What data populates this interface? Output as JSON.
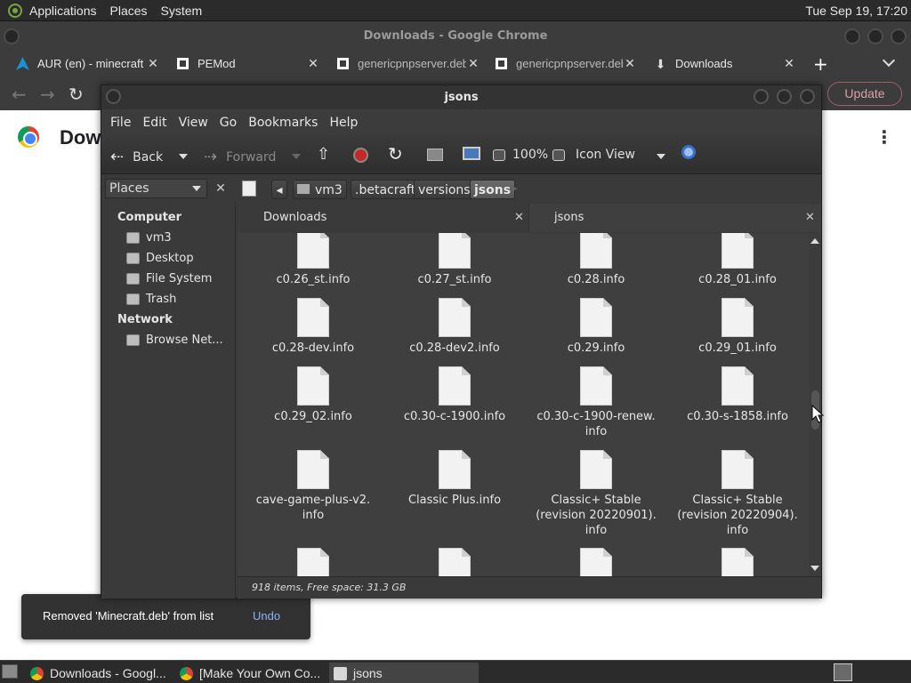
{
  "top_panel": {
    "menus": [
      "Applications",
      "Places",
      "System"
    ],
    "clock": "Tue Sep 19, 17:20"
  },
  "chrome": {
    "window_title": "Downloads - Google Chrome",
    "tabs": [
      {
        "label": "AUR (en) - minecraft",
        "icon": "arch-icon"
      },
      {
        "label": "PEMod",
        "icon": "github-icon"
      },
      {
        "label": "genericpnpserver.deb",
        "icon": "github-icon"
      },
      {
        "label": "genericpnpserver.deb",
        "icon": "github-icon"
      },
      {
        "label": "Downloads",
        "icon": "download-icon"
      }
    ],
    "update_label": "Update",
    "page_heading": "Dow",
    "snackbar": {
      "message": "Removed 'Minecraft.deb' from list",
      "action": "Undo"
    }
  },
  "caja": {
    "title": "jsons",
    "menu": [
      "File",
      "Edit",
      "View",
      "Go",
      "Bookmarks",
      "Help"
    ],
    "toolbar": {
      "back": "Back",
      "forward": "Forward",
      "zoom": "100%",
      "view_mode": "Icon View"
    },
    "places_label": "Places",
    "sidebar": {
      "computer_heading": "Computer",
      "computer_items": [
        "vm3",
        "Desktop",
        "File System",
        "Trash"
      ],
      "network_heading": "Network",
      "network_items": [
        "Browse Net..."
      ]
    },
    "breadcrumbs": [
      "vm3",
      ".betacraft",
      "versions",
      "jsons"
    ],
    "tabs": [
      "Downloads",
      "jsons"
    ],
    "files": [
      "c0.26_st.info",
      "c0.27_st.info",
      "c0.28.info",
      "c0.28_01.info",
      "c0.28-dev.info",
      "c0.28-dev2.info",
      "c0.29.info",
      "c0.29_01.info",
      "c0.29_02.info",
      "c0.30-c-1900.info",
      "c0.30-c-1900-renew.\ninfo",
      "c0.30-s-1858.info",
      "cave-game-plus-v2.\ninfo",
      "Classic Plus.info",
      "Classic+ Stable\n(revision 20220901).\ninfo",
      "Classic+ Stable\n(revision 20220904).\ninfo",
      "",
      "",
      "",
      ""
    ],
    "status": "918 items, Free space: 31.3 GB"
  },
  "taskbar": {
    "tasks": [
      "Downloads - Googl...",
      "[Make Your Own Co...",
      "jsons"
    ]
  }
}
